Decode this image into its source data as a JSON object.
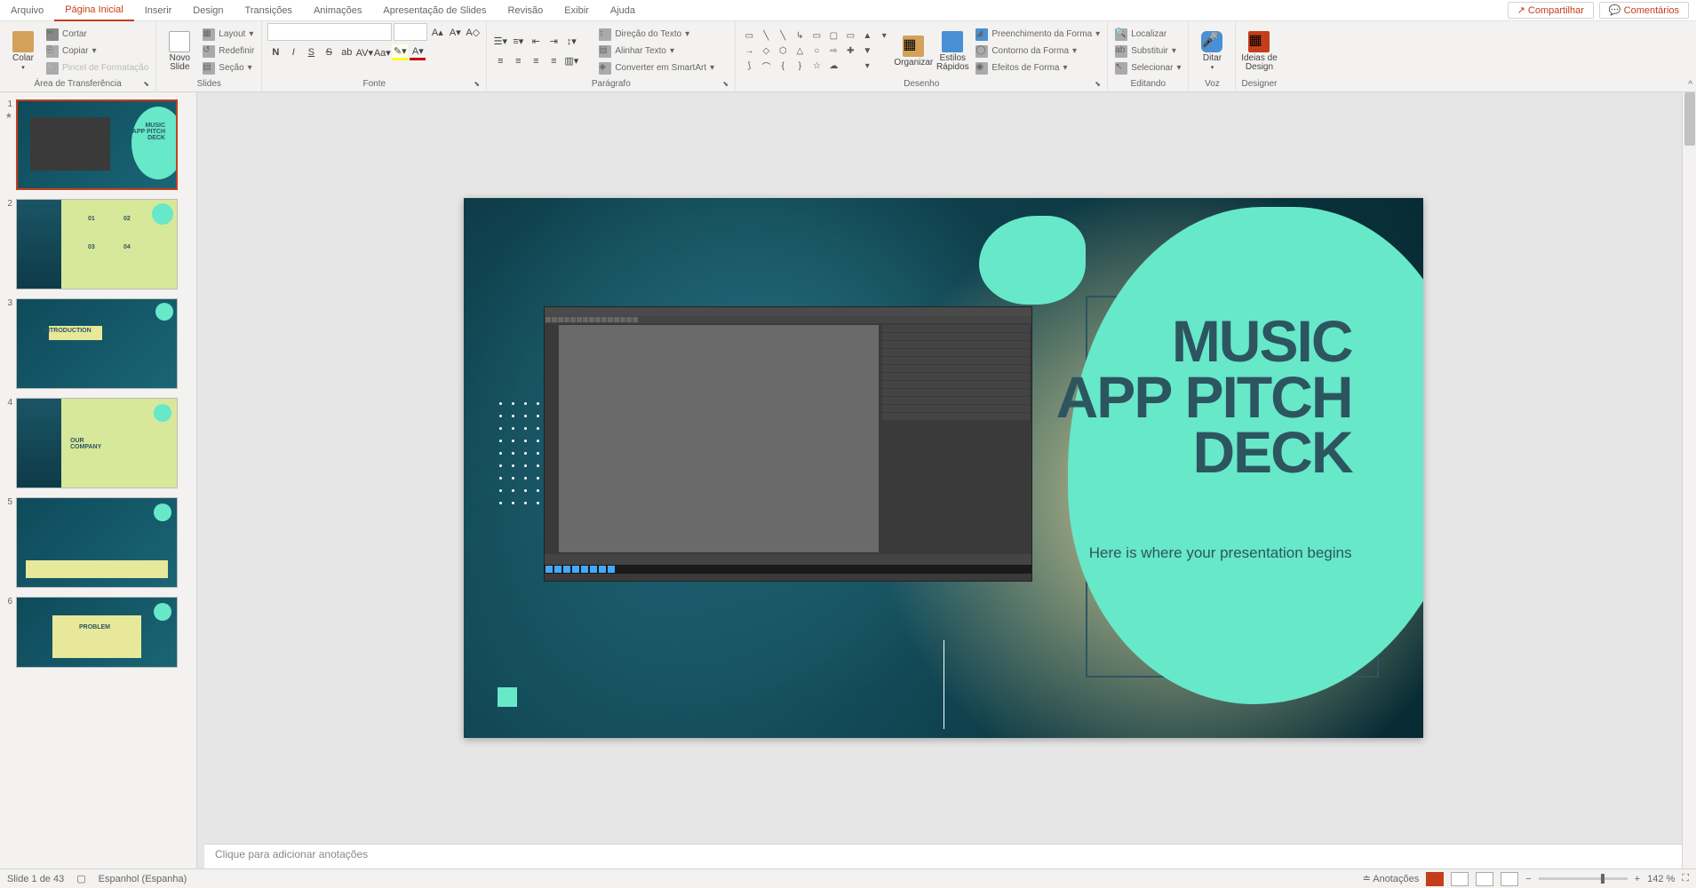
{
  "tabs": {
    "arquivo": "Arquivo",
    "home": "Página Inicial",
    "inserir": "Inserir",
    "design": "Design",
    "transicoes": "Transições",
    "animacoes": "Animações",
    "apresentacao": "Apresentação de Slides",
    "revisao": "Revisão",
    "exibir": "Exibir",
    "ajuda": "Ajuda",
    "compartilhar": "Compartilhar",
    "comentarios": "Comentários"
  },
  "ribbon": {
    "colar": "Colar",
    "cortar": "Cortar",
    "copiar": "Copiar",
    "pincel": "Pincel de Formatação",
    "clipboard_label": "Área de Transferência",
    "novo_slide": "Novo\nSlide",
    "layout": "Layout",
    "redefinir": "Redefinir",
    "secao": "Seção",
    "slides_label": "Slides",
    "fonte_label": "Fonte",
    "paragrafo_label": "Parágrafo",
    "direcao": "Direção do Texto",
    "alinhar": "Alinhar Texto",
    "smartart": "Converter em SmartArt",
    "organizar": "Organizar",
    "estilos": "Estilos\nRápidos",
    "preenchimento": "Preenchimento da Forma",
    "contorno": "Contorno da Forma",
    "efeitos": "Efeitos de Forma",
    "desenho_label": "Desenho",
    "localizar": "Localizar",
    "substituir": "Substituir",
    "selecionar": "Selecionar",
    "editando_label": "Editando",
    "ditar": "Ditar",
    "voz_label": "Voz",
    "ideias": "Ideias de\nDesign",
    "designer_label": "Designer"
  },
  "slide": {
    "title_l1": "MUSIC",
    "title_l2": "APP PITCH",
    "title_l3": "DECK",
    "subtitle": "Here is where your presentation begins"
  },
  "thumbs": {
    "t1_text": "MUSIC\nAPP PITCH\nDECK",
    "t2_01": "01",
    "t2_02": "02",
    "t2_03": "03",
    "t2_04": "04",
    "t3_text": "INTRODUCTION",
    "t4_text": "OUR\nCOMPANY",
    "t6_text": "PROBLEM"
  },
  "notes": {
    "placeholder": "Clique para adicionar anotações"
  },
  "status": {
    "slide_info": "Slide 1 de 43",
    "lang": "Espanhol (Espanha)",
    "anotacoes": "Anotações",
    "zoom": "142 %"
  }
}
